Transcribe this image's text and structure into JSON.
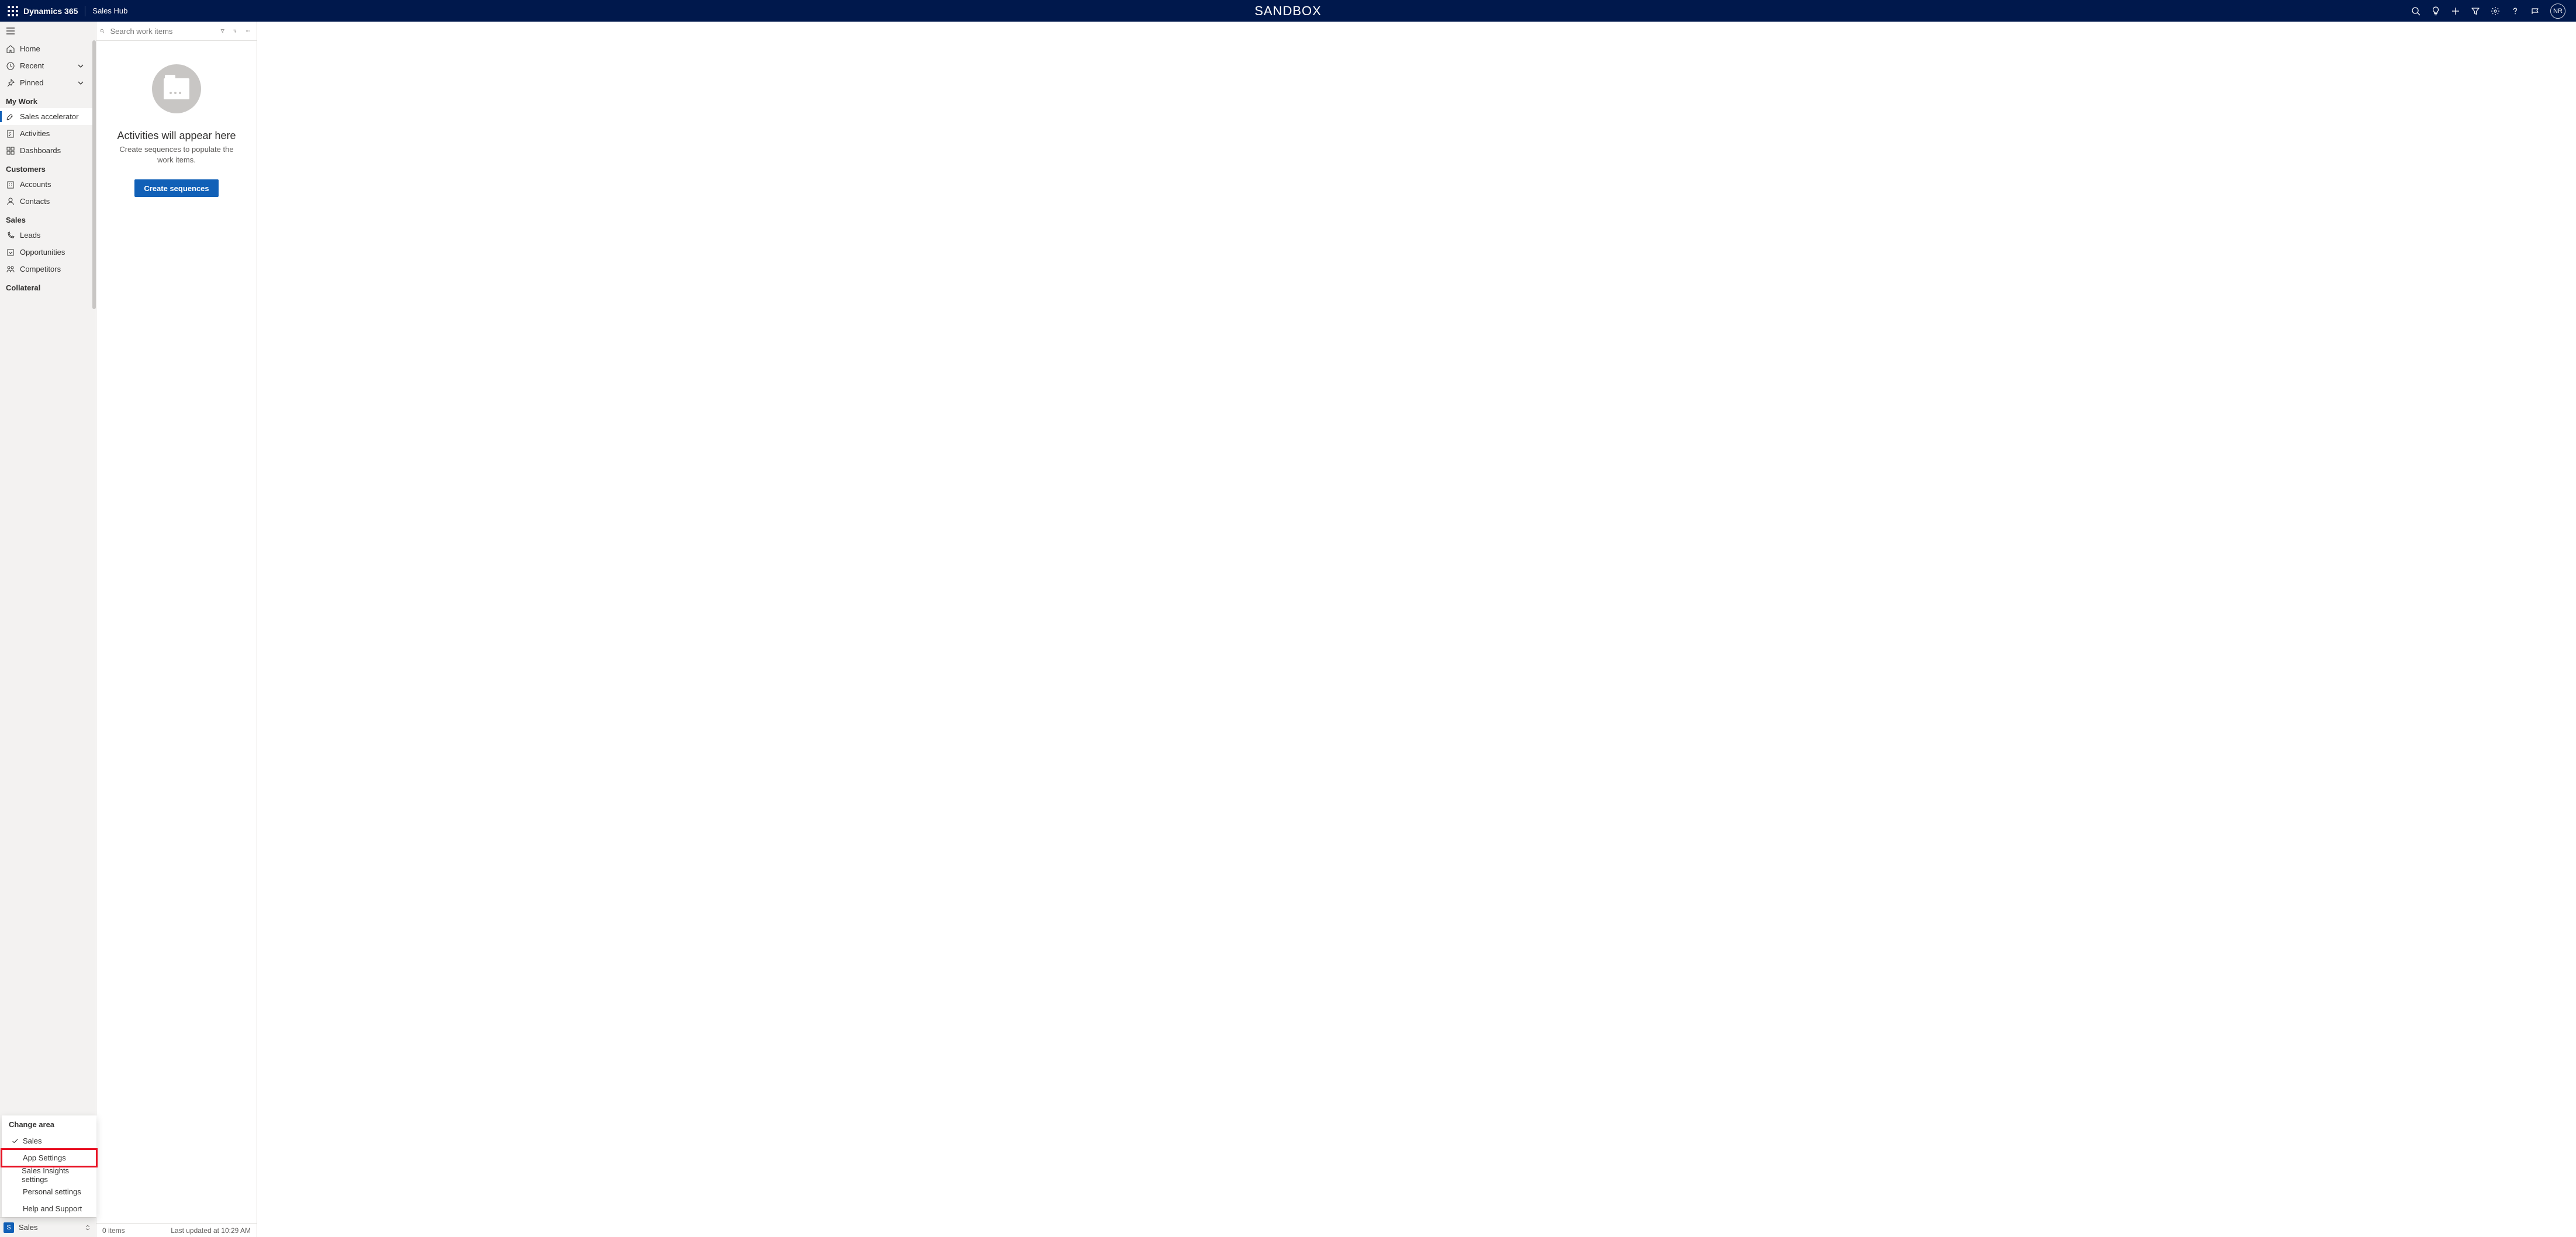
{
  "header": {
    "brand": "Dynamics 365",
    "app_name": "Sales Hub",
    "env_label": "SANDBOX",
    "avatar_initials": "NR"
  },
  "sidebar": {
    "home": "Home",
    "recent": "Recent",
    "pinned": "Pinned",
    "sections": {
      "my_work": "My Work",
      "customers": "Customers",
      "sales": "Sales",
      "collateral": "Collateral"
    },
    "items": {
      "sales_accelerator": "Sales accelerator",
      "activities": "Activities",
      "dashboards": "Dashboards",
      "accounts": "Accounts",
      "contacts": "Contacts",
      "leads": "Leads",
      "opportunities": "Opportunities",
      "competitors": "Competitors"
    }
  },
  "area_switcher": {
    "badge": "S",
    "current": "Sales",
    "popup_header": "Change area",
    "options": [
      "Sales",
      "App Settings",
      "Sales Insights settings",
      "Personal settings",
      "Help and Support"
    ]
  },
  "work_panel": {
    "search_placeholder": "Search work items",
    "empty_title": "Activities will appear here",
    "empty_sub": "Create sequences to populate the work items.",
    "create_btn": "Create sequences",
    "status_items": "0 items",
    "status_updated": "Last updated at 10:29 AM"
  }
}
